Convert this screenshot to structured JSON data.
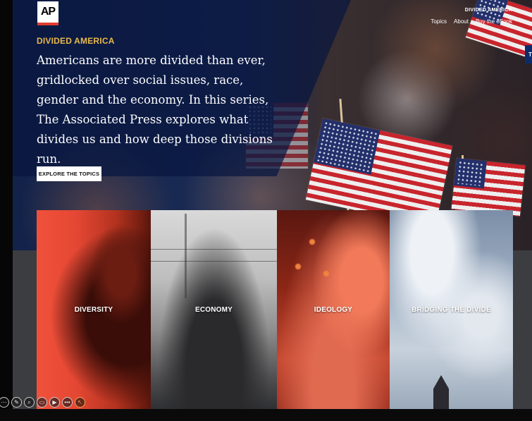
{
  "header": {
    "logo_text": "AP",
    "site_title": "DIVIDED AMERICA",
    "nav": [
      "Topics",
      "About",
      "Buy the eBook"
    ],
    "side_tab_text": "T"
  },
  "hero": {
    "series_label": "DIVIDED AMERICA",
    "intro": "Americans are more divided than ever, gridlocked over social issues, race, gender and the economy. In this series, The Associated Press explores what divides us and how deep those divisions run.",
    "cta_label": "EXPLORE THE TOPICS"
  },
  "topics": [
    {
      "label": "DIVERSITY"
    },
    {
      "label": "ECONOMY"
    },
    {
      "label": "IDEOLOGY"
    },
    {
      "label": "BRIDGING THE DIVIDE"
    }
  ],
  "toolbar": {
    "icons": [
      "pen-icon",
      "zoom-icon",
      "captions-icon",
      "camera-icon",
      "more-icon",
      "pointer-icon"
    ]
  },
  "colors": {
    "accent_gold": "#e8b94a",
    "ap_red": "#e03a2f",
    "navy": "#0b1a3c"
  }
}
